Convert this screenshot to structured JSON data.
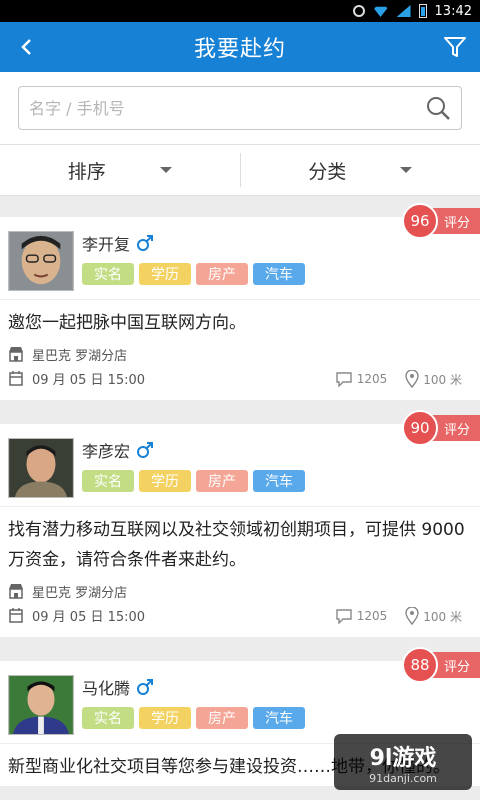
{
  "status_bar": {
    "time": "13:42"
  },
  "header": {
    "title": "我要赴约"
  },
  "search": {
    "placeholder": "名字 / 手机号"
  },
  "sortbar": {
    "sort_label": "排序",
    "category_label": "分类"
  },
  "badges": {
    "real": "实名",
    "edu": "学历",
    "house": "房产",
    "car": "汽车"
  },
  "score_label": "评分",
  "cards": [
    {
      "name": "李开复",
      "score": "96",
      "description": "邀您一起把脉中国互联网方向。",
      "place": "星巴克 罗湖分店",
      "time": "09 月 05 日   15:00",
      "comments": "1205",
      "distance": "100 米"
    },
    {
      "name": "李彦宏",
      "score": "90",
      "description": "找有潜力移动互联网以及社交领域初创期项目，可提供 9000 万资金，请符合条件者来赴约。",
      "place": "星巴克 罗湖分店",
      "time": "09 月 05 日   15:00",
      "comments": "1205",
      "distance": "100 米"
    },
    {
      "name": "马化腾",
      "score": "88",
      "description": "新型商业化社交项目等您参与建设投资……地带，你懂的。"
    }
  ],
  "watermark": {
    "title": "9l游戏",
    "site": "91danji.com"
  },
  "colors": {
    "primary": "#1781d6",
    "score": "#e55050"
  }
}
